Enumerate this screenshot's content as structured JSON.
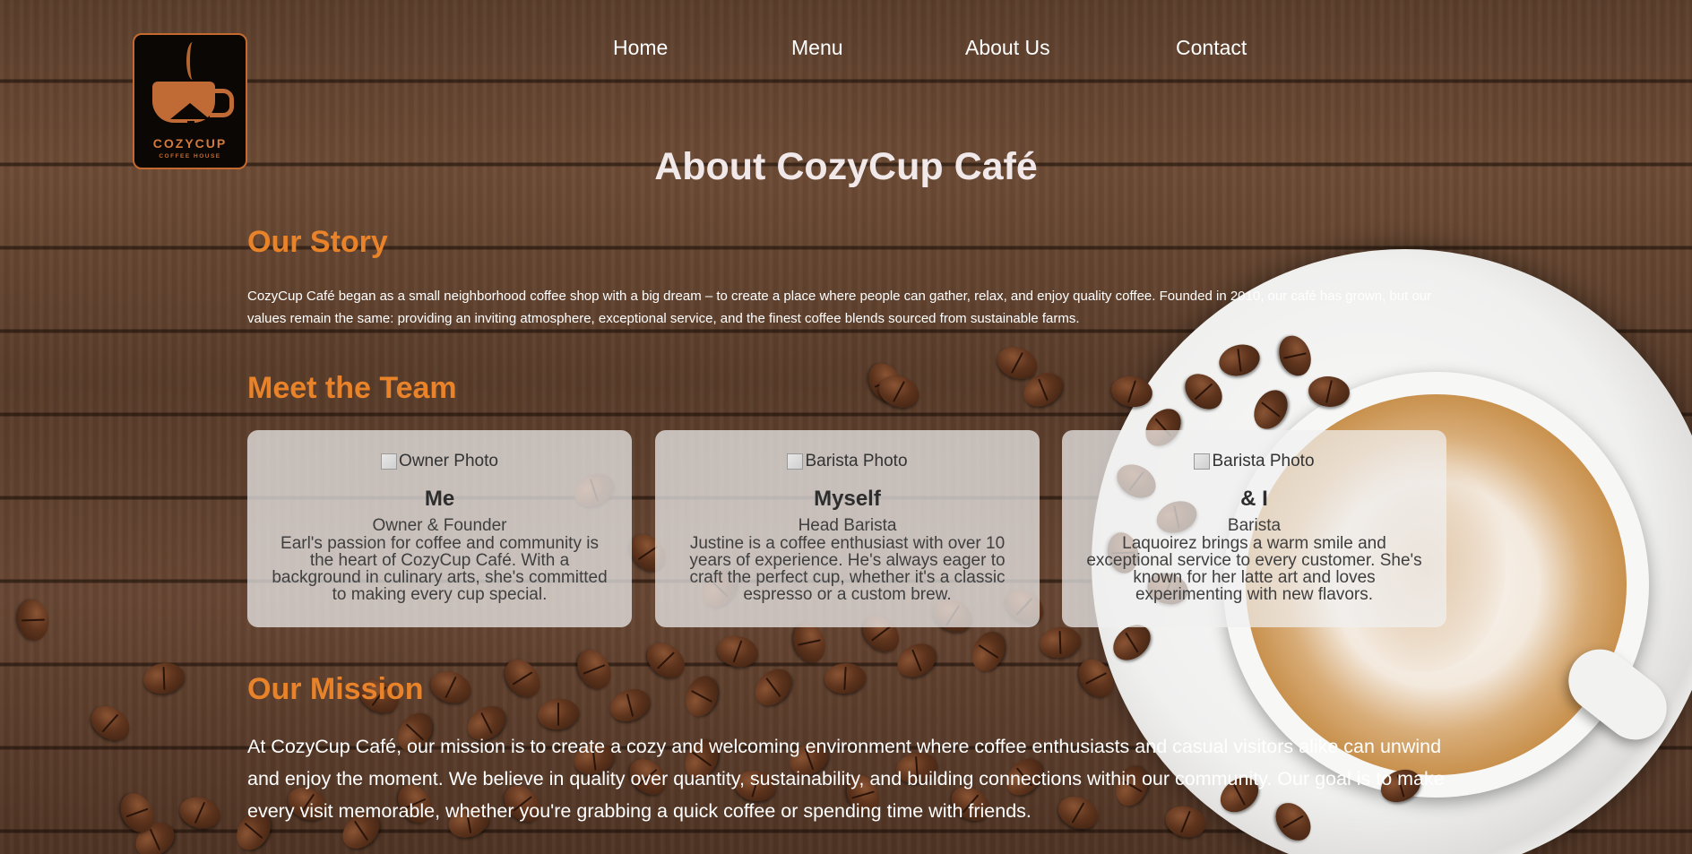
{
  "brand": {
    "name": "COZYCUP",
    "tagline": "COFFEE HOUSE",
    "colors": {
      "accent": "#e8832a",
      "logo_bg": "#0a0705",
      "card_bg": "#f0f0f0"
    }
  },
  "nav": {
    "items": [
      {
        "label": "Home"
      },
      {
        "label": "Menu"
      },
      {
        "label": "About Us"
      },
      {
        "label": "Contact"
      }
    ]
  },
  "page_title": "About CozyCup Café",
  "story": {
    "heading": "Our Story",
    "text": "CozyCup Café began as a small neighborhood coffee shop with a big dream – to create a place where people can gather, relax, and enjoy quality coffee. Founded in 2010, our café has grown, but our values remain the same: providing an inviting atmosphere, exceptional service, and the finest coffee blends sourced from sustainable farms."
  },
  "team": {
    "heading": "Meet the Team",
    "members": [
      {
        "photo_alt": "Owner Photo",
        "name": "Me",
        "role": "Owner & Founder",
        "bio": "Earl's passion for coffee and community is the heart of CozyCup Café. With a background in culinary arts, she's committed to making every cup special."
      },
      {
        "photo_alt": "Barista Photo",
        "name": "Myself",
        "role": "Head Barista",
        "bio": "Justine is a coffee enthusiast with over 10 years of experience. He's always eager to craft the perfect cup, whether it's a classic espresso or a custom brew."
      },
      {
        "photo_alt": "Barista Photo",
        "name": "& I",
        "role": "Barista",
        "bio": "Laquoirez brings a warm smile and exceptional service to every customer. She's known for her latte art and loves experimenting with new flavors."
      }
    ]
  },
  "mission": {
    "heading": "Our Mission",
    "text": "At CozyCup Café, our mission is to create a cozy and welcoming environment where coffee enthusiasts and casual visitors alike can unwind and enjoy the moment. We believe in quality over quantity, sustainability, and building connections within our community. Our goal is to make every visit memorable, whether you're grabbing a quick coffee or spending time with friends."
  }
}
